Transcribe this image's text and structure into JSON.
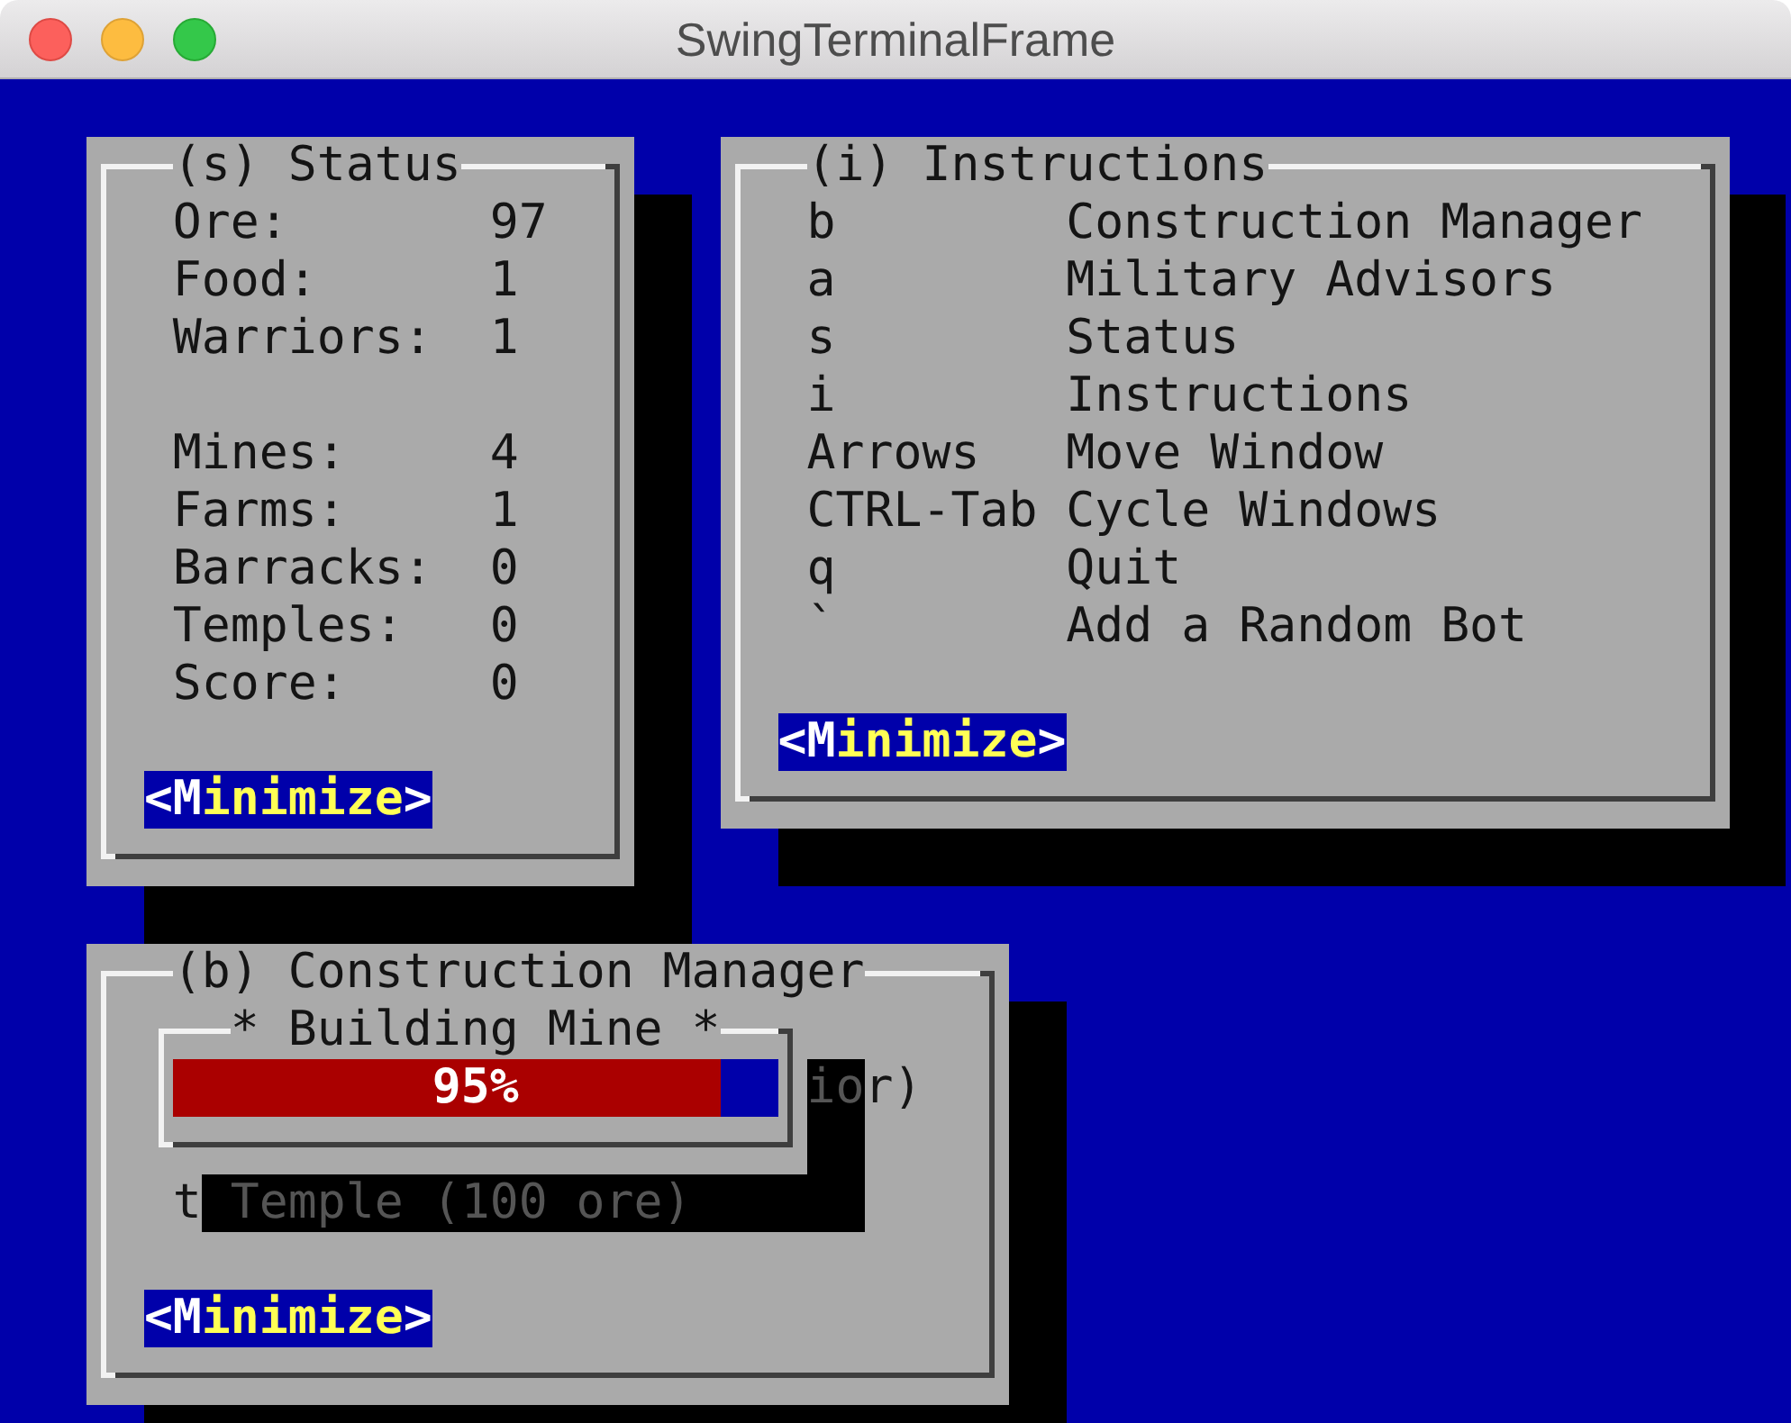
{
  "window": {
    "title": "SwingTerminalFrame"
  },
  "status": {
    "title": "(s) Status",
    "stat_groups": [
      {
        "stats": [
          {
            "label": "Ore:",
            "value": "97"
          },
          {
            "label": "Food:",
            "value": "1"
          },
          {
            "label": "Warriors:",
            "value": "1"
          }
        ]
      },
      {
        "stats": [
          {
            "label": "Mines:",
            "value": "4"
          },
          {
            "label": "Farms:",
            "value": "1"
          },
          {
            "label": "Barracks:",
            "value": "0"
          },
          {
            "label": "Temples:",
            "value": "0"
          },
          {
            "label": "Score:",
            "value": "0"
          }
        ]
      }
    ],
    "button": "<Minimize>"
  },
  "instructions": {
    "title": "(i) Instructions",
    "commands": [
      {
        "key": "b",
        "action": "Construction Manager"
      },
      {
        "key": "a",
        "action": "Military Advisors"
      },
      {
        "key": "s",
        "action": "Status"
      },
      {
        "key": "i",
        "action": "Instructions"
      },
      {
        "key": "Arrows",
        "action": "Move Window"
      },
      {
        "key": "CTRL-Tab",
        "action": "Cycle Windows"
      },
      {
        "key": "q",
        "action": "Quit"
      },
      {
        "key": "`",
        "action": "Add a Random Bot"
      }
    ],
    "button": "<Minimize>"
  },
  "construction_manager": {
    "title": "(b) Construction Manager",
    "options": [
      {
        "kind": "partial",
        "label": "ior)"
      },
      {
        "kind": "full",
        "hotkey": "t",
        "label": "Temple (100 ore)"
      }
    ],
    "button": "<Minimize>"
  },
  "building_dialog": {
    "title": "* Building Mine *",
    "progress": {
      "level": 0.95,
      "label": "95%"
    }
  }
}
